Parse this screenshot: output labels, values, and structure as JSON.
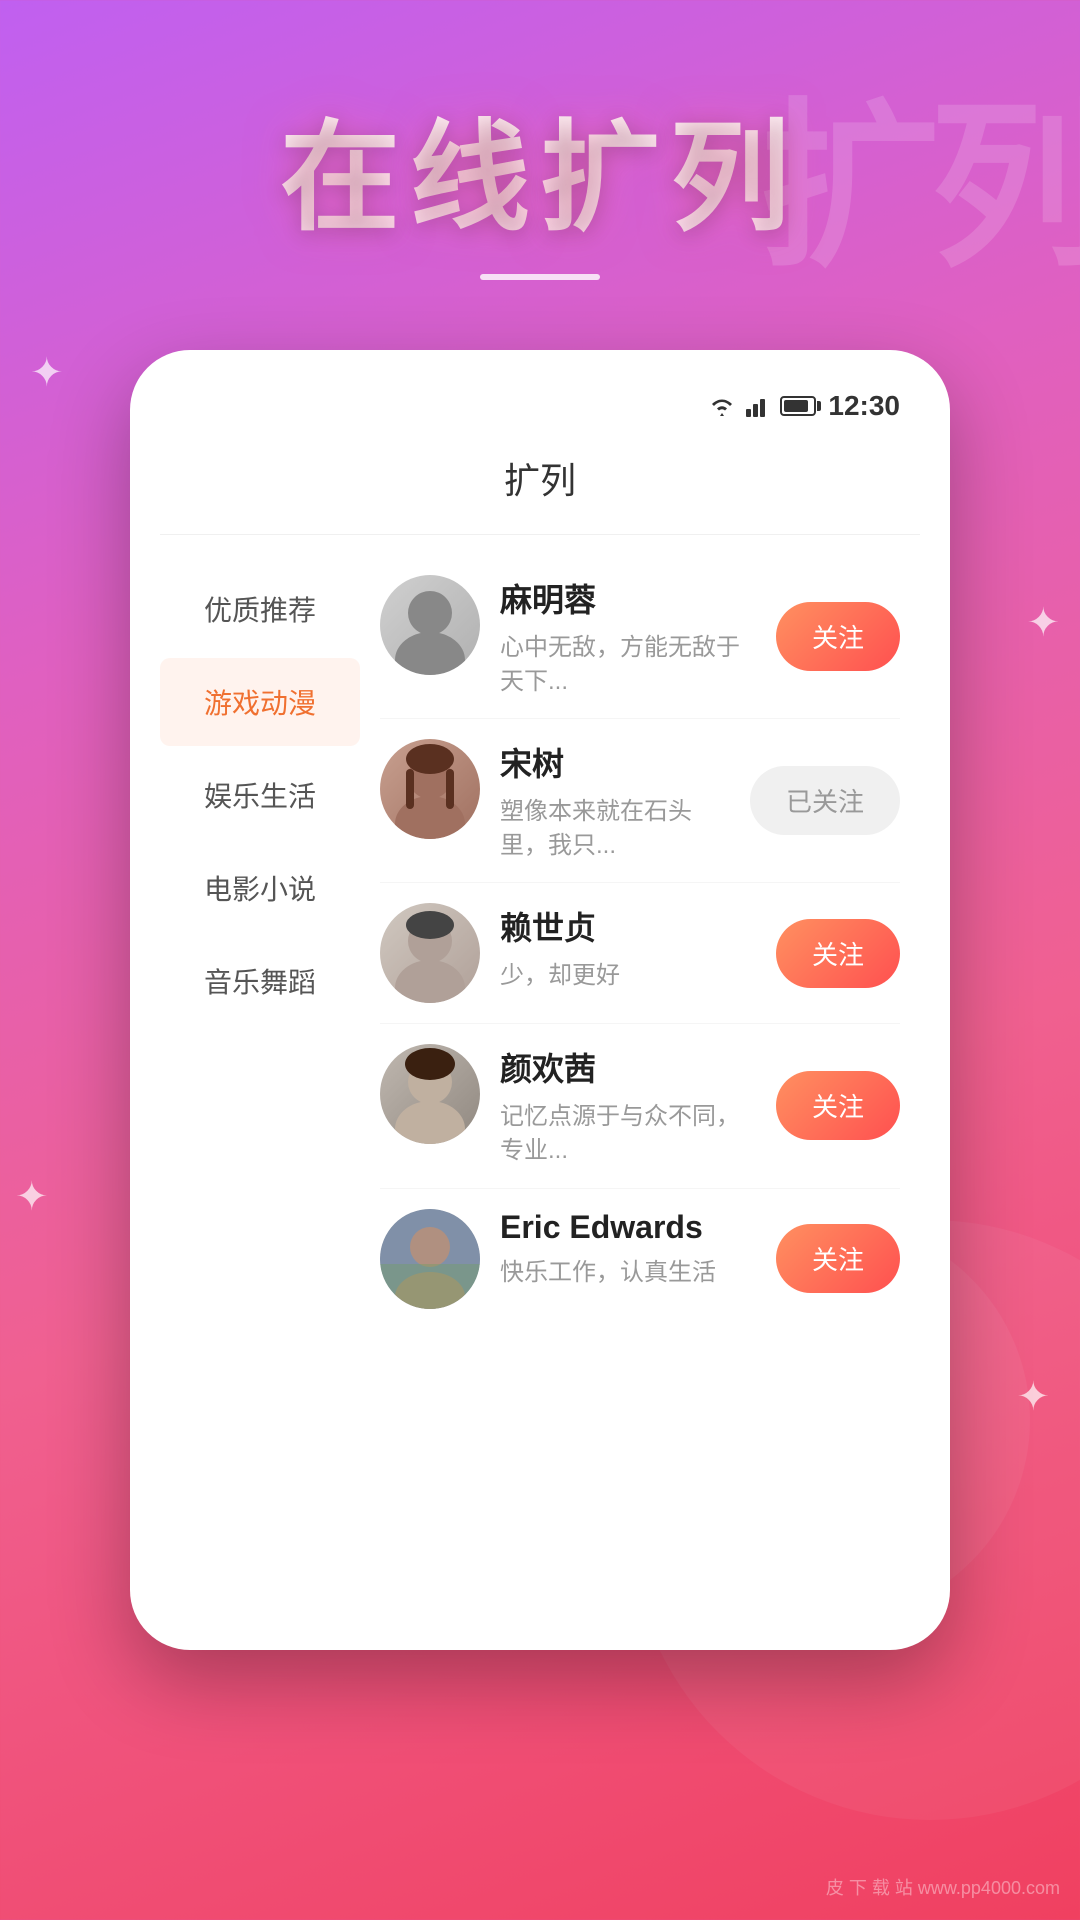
{
  "background": {
    "bg_text": "扩列"
  },
  "header": {
    "main_title": "在线扩列",
    "divider": true
  },
  "status_bar": {
    "time": "12:30"
  },
  "app": {
    "title": "扩列"
  },
  "sidebar": {
    "items": [
      {
        "id": "quality",
        "label": "优质推荐",
        "active": false
      },
      {
        "id": "game",
        "label": "游戏动漫",
        "active": true
      },
      {
        "id": "entertainment",
        "label": "娱乐生活",
        "active": false
      },
      {
        "id": "movie",
        "label": "电影小说",
        "active": false
      },
      {
        "id": "music",
        "label": "音乐舞蹈",
        "active": false
      }
    ]
  },
  "users": [
    {
      "id": 1,
      "name": "麻明蓉",
      "bio": "心中无敌，方能无敌于天下...",
      "follow_status": "unfollow",
      "follow_label": "关注",
      "avatar_class": "avatar-1"
    },
    {
      "id": 2,
      "name": "宋树",
      "bio": "塑像本来就在石头里，我只...",
      "follow_status": "followed",
      "follow_label": "已关注",
      "avatar_class": "avatar-2"
    },
    {
      "id": 3,
      "name": "赖世贞",
      "bio": "少，却更好",
      "follow_status": "unfollow",
      "follow_label": "关注",
      "avatar_class": "avatar-3"
    },
    {
      "id": 4,
      "name": "颜欢茜",
      "bio": "记忆点源于与众不同，专业...",
      "follow_status": "unfollow",
      "follow_label": "关注",
      "avatar_class": "avatar-4"
    },
    {
      "id": 5,
      "name": "Eric Edwards",
      "bio": "快乐工作，认真生活",
      "follow_status": "unfollow",
      "follow_label": "关注",
      "avatar_class": "avatar-5"
    }
  ],
  "watermark": "皮 下 载 站\nwww.pp4000.com"
}
